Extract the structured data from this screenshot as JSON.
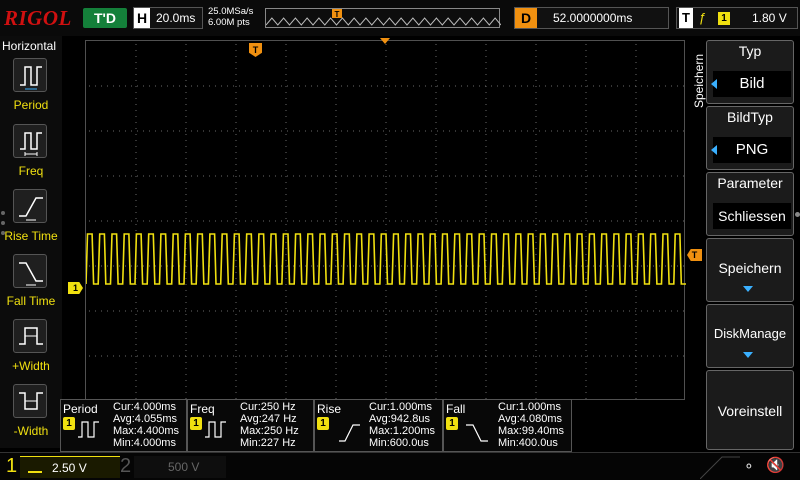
{
  "brand": "RIGOL",
  "status": {
    "trigger_state": "T'D"
  },
  "horizontal": {
    "tag": "H",
    "timebase": "20.0ms",
    "sample_rate": "25.0MSa/s",
    "memory_depth": "6.00M pts"
  },
  "delay": {
    "tag": "D",
    "value": "52.0000000ms"
  },
  "trigger": {
    "tag": "T",
    "edge_icon": "rising-edge-icon",
    "source": "1",
    "level": "1.80 V",
    "marker_label": "T"
  },
  "left_panel": {
    "title": "Horizontal",
    "items": [
      {
        "label": "Period",
        "icon": "period-icon"
      },
      {
        "label": "Freq",
        "icon": "freq-icon"
      },
      {
        "label": "Rise Time",
        "icon": "rise-time-icon"
      },
      {
        "label": "Fall Time",
        "icon": "fall-time-icon"
      },
      {
        "label": "+Width",
        "icon": "pos-width-icon"
      },
      {
        "label": "-Width",
        "icon": "neg-width-icon"
      }
    ]
  },
  "channel_marker": "1",
  "waveform": {
    "channel": 1,
    "color": "#f0e010",
    "shape": "square",
    "visible_cycles": 49
  },
  "results": [
    {
      "name": "Period",
      "channel": "1",
      "lines": [
        "Cur:4.000ms",
        "Avg:4.055ms",
        "Max:4.400ms",
        "Min:4.000ms"
      ]
    },
    {
      "name": "Freq",
      "channel": "1",
      "lines": [
        "Cur:250 Hz",
        "Avg:247 Hz",
        "Max:250 Hz",
        "Min:227 Hz"
      ]
    },
    {
      "name": "Rise",
      "channel": "1",
      "lines": [
        "Cur:1.000ms",
        "Avg:942.8us",
        "Max:1.200ms",
        "Min:600.0us"
      ]
    },
    {
      "name": "Fall",
      "channel": "1",
      "lines": [
        "Cur:1.000ms",
        "Avg:4.080ms",
        "Max:99.40ms",
        "Min:400.0us"
      ]
    }
  ],
  "channels": [
    {
      "number": "1",
      "scale": "2.50 V",
      "color": "#f0e010",
      "active": true
    },
    {
      "number": "2",
      "scale": "500 V",
      "color": "#555555",
      "active": false
    }
  ],
  "menu": {
    "title": "Speichern",
    "keys": [
      {
        "title": "Typ",
        "value": "Bild"
      },
      {
        "title": "BildTyp",
        "value": "PNG"
      },
      {
        "title": "Parameter",
        "value": "Schliessen"
      },
      {
        "label": "Speichern"
      },
      {
        "label": "DiskManage"
      },
      {
        "label": "Voreinstell"
      }
    ]
  },
  "icons": {
    "usb": "usb-icon",
    "speaker": "speaker-muted-icon"
  },
  "colors": {
    "ch1": "#f0e010",
    "trigger": "#f09010",
    "logo": "#d01010",
    "status_ok": "#14803a",
    "menu_arrow": "#3ab0ff"
  }
}
